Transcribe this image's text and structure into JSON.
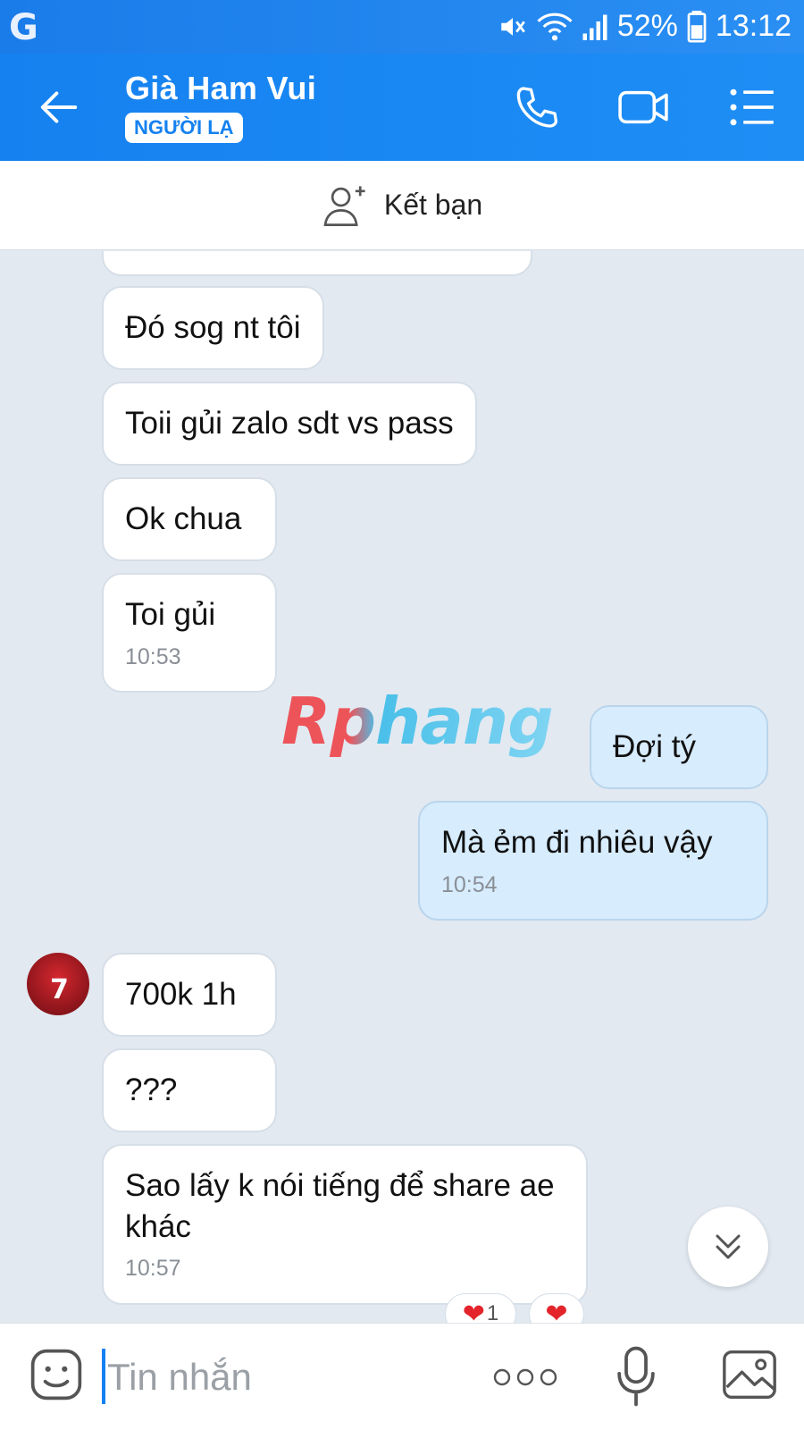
{
  "status_bar": {
    "brand_letter": "G",
    "battery": "52%",
    "time": "13:12"
  },
  "header": {
    "contact_name": "Già Ham Vui",
    "stranger_badge": "NGƯỜI LẠ"
  },
  "add_friend": {
    "label": "Kết bạn"
  },
  "watermark": "Rphang",
  "messages": {
    "m1": {
      "text": "Đó sog nt tôi"
    },
    "m2": {
      "text": "Toii gủi zalo sdt vs pass"
    },
    "m3": {
      "text": "Ok chua"
    },
    "m4": {
      "text": "Toi gủi",
      "time": "10:53"
    },
    "m5": {
      "text": "Đợi tý"
    },
    "m6": {
      "text": "Mà ẻm đi nhiêu vậy",
      "time": "10:54"
    },
    "m7": {
      "text": "700k 1h"
    },
    "m8": {
      "text": "???"
    },
    "m9": {
      "text": "Sao lấy k nói tiếng để share ae khác",
      "time": "10:57"
    }
  },
  "reactions": {
    "heart_count": "1"
  },
  "input": {
    "placeholder": "Tin nhắn"
  },
  "colors": {
    "header_blue": "#1581f0",
    "chat_bg": "#e2e9f1",
    "my_bubble": "#d7ecfd",
    "their_bubble": "#ffffff"
  },
  "icons": [
    "back-arrow-icon",
    "phone-icon",
    "video-camera-icon",
    "menu-list-icon",
    "add-friend-icon",
    "emoji-icon",
    "more-options-icon",
    "microphone-icon",
    "image-icon",
    "scroll-down-icon",
    "heart-icon"
  ]
}
